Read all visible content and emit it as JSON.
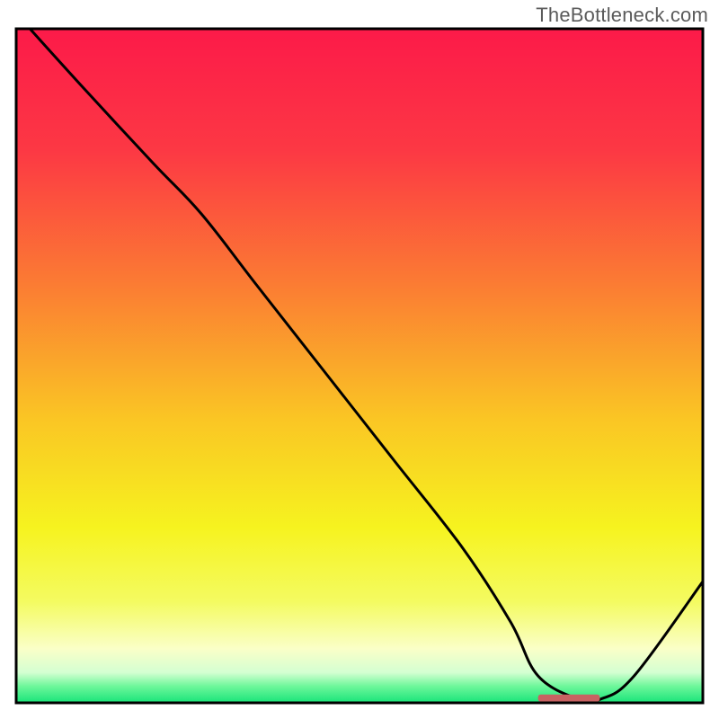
{
  "watermark": "TheBottleneck.com",
  "colors": {
    "frame": "#000000",
    "curve": "#000000",
    "marker": "#c86262",
    "gradient_stops": [
      {
        "offset": 0.0,
        "color": "#fc1a49"
      },
      {
        "offset": 0.18,
        "color": "#fc3844"
      },
      {
        "offset": 0.38,
        "color": "#fb7c33"
      },
      {
        "offset": 0.58,
        "color": "#fac624"
      },
      {
        "offset": 0.74,
        "color": "#f6f31f"
      },
      {
        "offset": 0.85,
        "color": "#f4fb61"
      },
      {
        "offset": 0.92,
        "color": "#faffc8"
      },
      {
        "offset": 0.955,
        "color": "#d4ffd2"
      },
      {
        "offset": 0.975,
        "color": "#6ff79b"
      },
      {
        "offset": 1.0,
        "color": "#18e479"
      }
    ]
  },
  "chart_data": {
    "type": "line",
    "title": "",
    "xlabel": "",
    "ylabel": "",
    "xlim": [
      0,
      100
    ],
    "ylim": [
      0,
      100
    ],
    "series": [
      {
        "name": "bottleneck-curve",
        "x": [
          2,
          10,
          20,
          27,
          35,
          45,
          55,
          65,
          72,
          76,
          82,
          85,
          90,
          100
        ],
        "y": [
          100,
          91,
          80,
          72.5,
          62,
          49,
          36,
          23,
          12,
          4,
          0.5,
          0.5,
          4,
          18
        ]
      }
    ],
    "marker": {
      "name": "optimal-range-bar",
      "x_start": 76,
      "x_end": 85,
      "y": 0.7,
      "thickness_px": 8
    }
  }
}
